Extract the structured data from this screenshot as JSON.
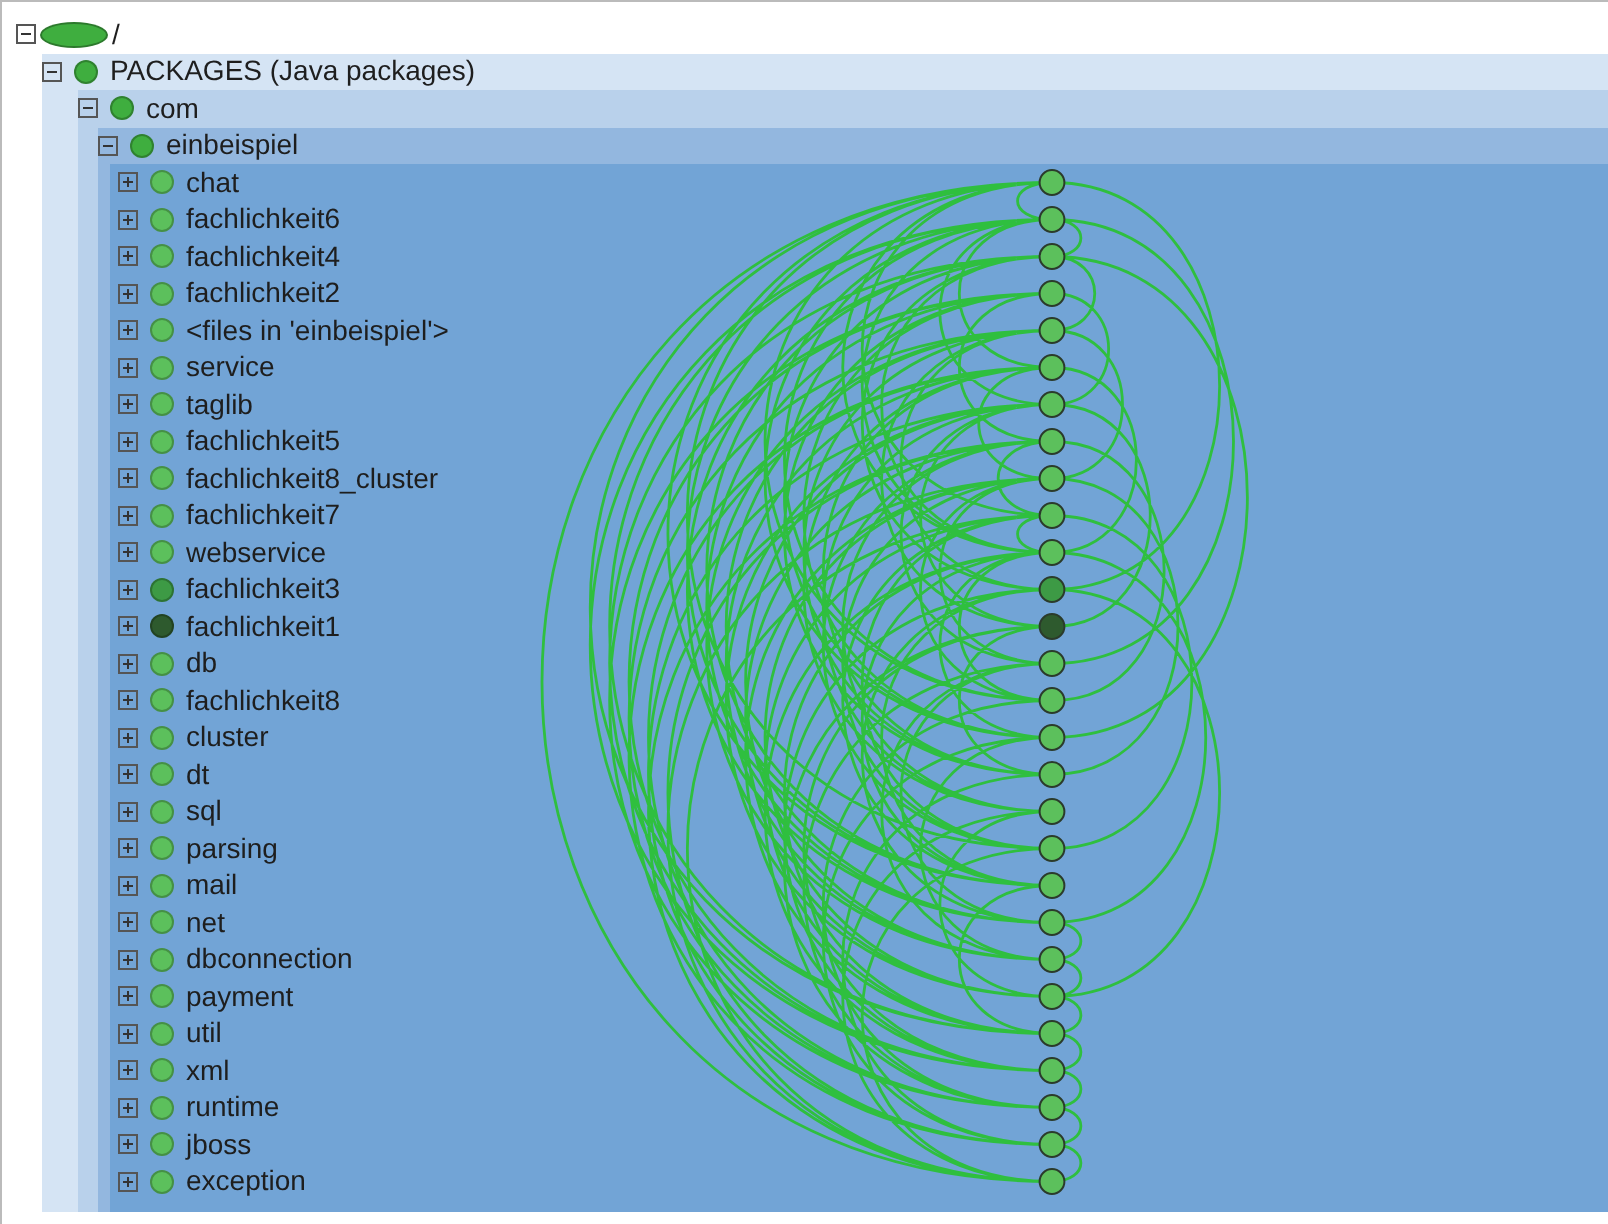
{
  "tree": {
    "label": "/",
    "expanded": true,
    "color": "#3fae3f",
    "children": [
      {
        "label": "PACKAGES (Java packages)",
        "expanded": true,
        "color": "#3fae3f",
        "children": [
          {
            "label": "com",
            "expanded": true,
            "color": "#3fae3f",
            "children": [
              {
                "label": "einbeispiel",
                "expanded": true,
                "color": "#3fae3f",
                "children": [
                  {
                    "label": "chat",
                    "expanded": false,
                    "color": "#5cc05c"
                  },
                  {
                    "label": "fachlichkeit6",
                    "expanded": false,
                    "color": "#5cc05c"
                  },
                  {
                    "label": "fachlichkeit4",
                    "expanded": false,
                    "color": "#5cc05c"
                  },
                  {
                    "label": "fachlichkeit2",
                    "expanded": false,
                    "color": "#5cc05c"
                  },
                  {
                    "label": "<files in 'einbeispiel'>",
                    "expanded": false,
                    "color": "#5cc05c"
                  },
                  {
                    "label": "service",
                    "expanded": false,
                    "color": "#5cc05c"
                  },
                  {
                    "label": "taglib",
                    "expanded": false,
                    "color": "#5cc05c"
                  },
                  {
                    "label": "fachlichkeit5",
                    "expanded": false,
                    "color": "#5cc05c"
                  },
                  {
                    "label": "fachlichkeit8_cluster",
                    "expanded": false,
                    "color": "#5cc05c"
                  },
                  {
                    "label": "fachlichkeit7",
                    "expanded": false,
                    "color": "#5cc05c"
                  },
                  {
                    "label": "webservice",
                    "expanded": false,
                    "color": "#5cc05c"
                  },
                  {
                    "label": "fachlichkeit3",
                    "expanded": false,
                    "color": "#3d9a45"
                  },
                  {
                    "label": "fachlichkeit1",
                    "expanded": false,
                    "color": "#2e5a2e"
                  },
                  {
                    "label": "db",
                    "expanded": false,
                    "color": "#5cc05c"
                  },
                  {
                    "label": "fachlichkeit8",
                    "expanded": false,
                    "color": "#5cc05c"
                  },
                  {
                    "label": "cluster",
                    "expanded": false,
                    "color": "#5cc05c"
                  },
                  {
                    "label": "dt",
                    "expanded": false,
                    "color": "#5cc05c"
                  },
                  {
                    "label": "sql",
                    "expanded": false,
                    "color": "#5cc05c"
                  },
                  {
                    "label": "parsing",
                    "expanded": false,
                    "color": "#5cc05c"
                  },
                  {
                    "label": "mail",
                    "expanded": false,
                    "color": "#5cc05c"
                  },
                  {
                    "label": "net",
                    "expanded": false,
                    "color": "#5cc05c"
                  },
                  {
                    "label": "dbconnection",
                    "expanded": false,
                    "color": "#5cc05c"
                  },
                  {
                    "label": "payment",
                    "expanded": false,
                    "color": "#5cc05c"
                  },
                  {
                    "label": "util",
                    "expanded": false,
                    "color": "#5cc05c"
                  },
                  {
                    "label": "xml",
                    "expanded": false,
                    "color": "#5cc05c"
                  },
                  {
                    "label": "runtime",
                    "expanded": false,
                    "color": "#5cc05c"
                  },
                  {
                    "label": "jboss",
                    "expanded": false,
                    "color": "#5cc05c"
                  },
                  {
                    "label": "exception",
                    "expanded": false,
                    "color": "#5cc05c"
                  }
                ]
              }
            ]
          }
        ]
      }
    ]
  }
}
